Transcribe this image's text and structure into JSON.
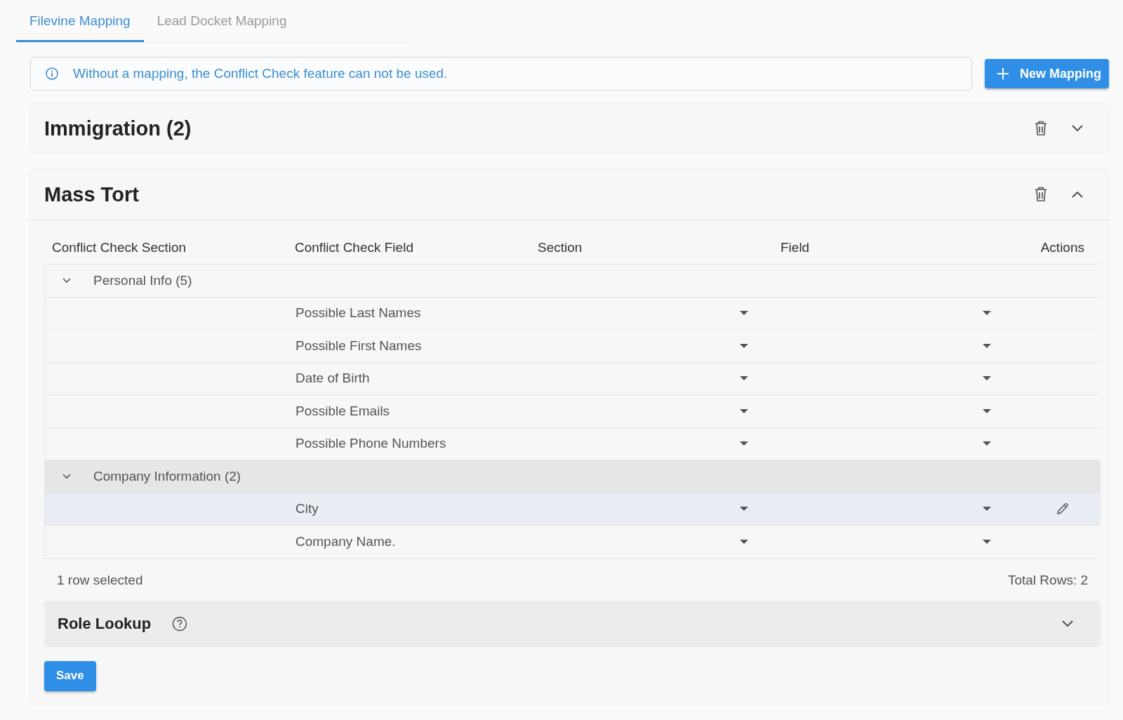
{
  "tabs": [
    {
      "label": "Filevine Mapping",
      "selected": true
    },
    {
      "label": "Lead Docket Mapping",
      "selected": false
    }
  ],
  "info": {
    "text": "Without a mapping, the Conflict Check feature can not be used."
  },
  "new_button": {
    "label": "New Mapping"
  },
  "mappings": [
    {
      "title": "Immigration (2)",
      "expanded": false
    },
    {
      "title": "Mass Tort",
      "expanded": true,
      "table": {
        "columns": [
          "Conflict Check Section",
          "Conflict Check Field",
          "Section",
          "Field",
          "Actions"
        ],
        "groups": [
          {
            "label": "Personal Info (5)",
            "expanded": true,
            "hovered": false,
            "rows": [
              {
                "field": "Possible Last Names",
                "selected": false
              },
              {
                "field": "Possible First Names",
                "selected": false
              },
              {
                "field": "Date of Birth",
                "selected": false
              },
              {
                "field": "Possible Emails",
                "selected": false
              },
              {
                "field": "Possible Phone Numbers",
                "selected": false
              }
            ]
          },
          {
            "label": "Company Information (2)",
            "expanded": true,
            "hovered": true,
            "rows": [
              {
                "field": "City",
                "selected": true
              },
              {
                "field": "Company Name.",
                "selected": false
              }
            ]
          }
        ],
        "selection_status": "1 row selected",
        "total": "Total Rows: 2"
      },
      "role_lookup": {
        "title": "Role Lookup",
        "expanded": false
      },
      "save": "Save"
    }
  ]
}
